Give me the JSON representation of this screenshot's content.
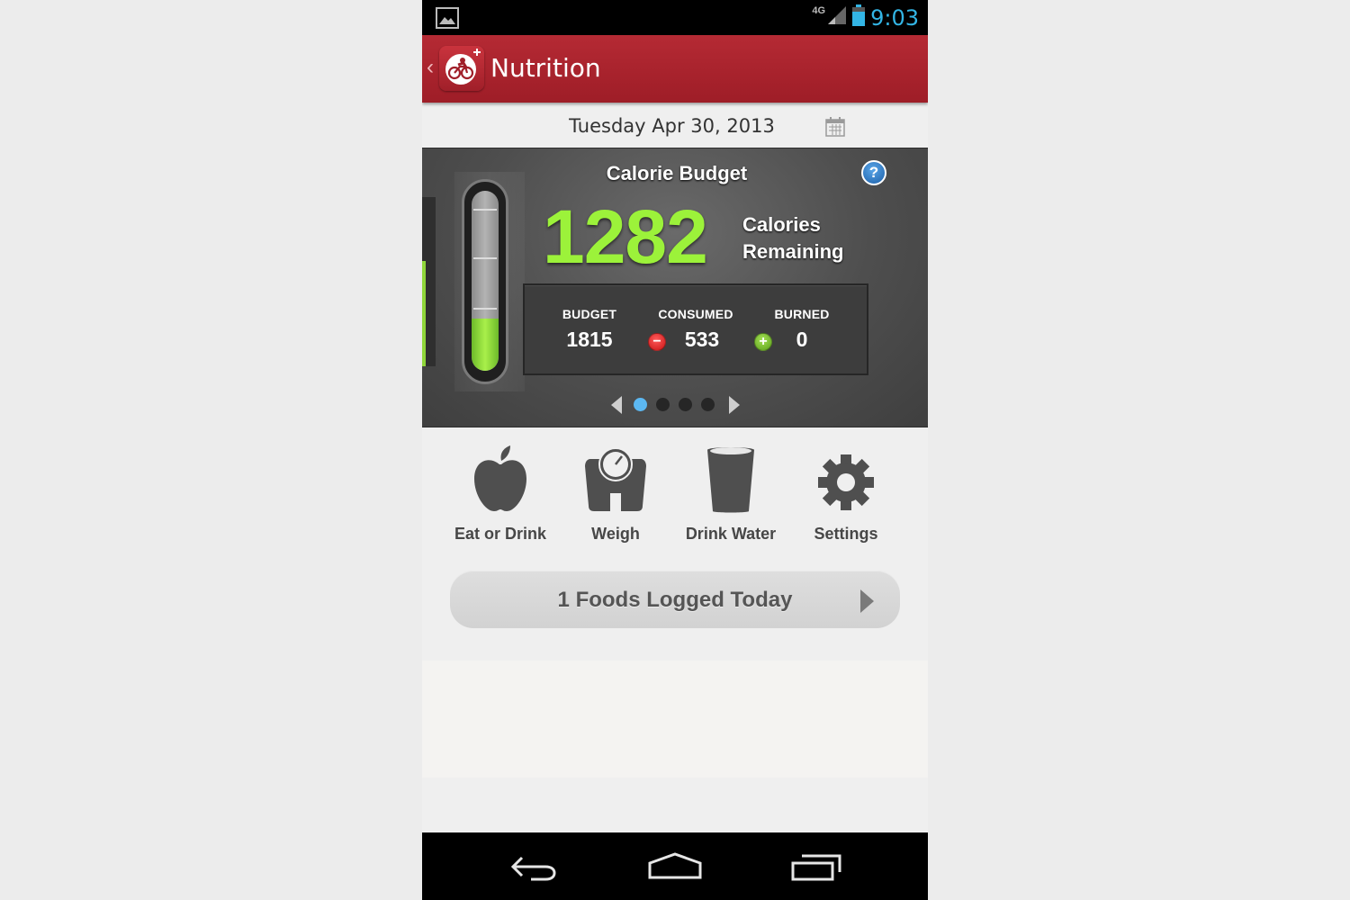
{
  "status_bar": {
    "time": "9:03",
    "network": "4G",
    "icons": [
      "gallery-icon",
      "signal-icon",
      "battery-icon"
    ],
    "time_color": "#33b5e5"
  },
  "action_bar": {
    "title": "Nutrition",
    "back_glyph": "‹",
    "color": "#ab2530"
  },
  "date": {
    "label": "Tuesday Apr 30, 2013"
  },
  "calorie_budget": {
    "title": "Calorie Budget",
    "help_label": "?",
    "remaining_value": "1282",
    "remaining_label_line1": "Calories",
    "remaining_label_line2": "Remaining",
    "fill_fraction": 0.29,
    "stats": {
      "budget_label": "BUDGET",
      "budget_value": "1815",
      "consumed_label": "CONSUMED",
      "consumed_value": "533",
      "burned_label": "BURNED",
      "burned_value": "0"
    },
    "pager": {
      "page_count": 4,
      "active_page": 1
    },
    "accent_color": "#9cf23a"
  },
  "actions": [
    {
      "label": "Eat or Drink",
      "icon": "apple-icon"
    },
    {
      "label": "Weigh",
      "icon": "scale-icon"
    },
    {
      "label": "Drink Water",
      "icon": "glass-icon"
    },
    {
      "label": "Settings",
      "icon": "gear-icon"
    }
  ],
  "foods_logged": {
    "label": "1 Foods Logged Today"
  },
  "nav_bar": {
    "icons": [
      "back-icon",
      "home-icon",
      "recent-apps-icon"
    ]
  }
}
